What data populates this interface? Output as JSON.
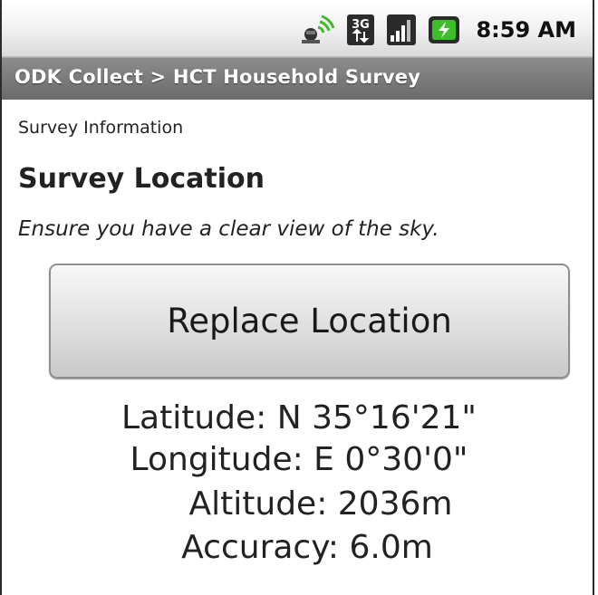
{
  "status_bar": {
    "time": "8:59 AM",
    "icons": [
      "gps-satellite-icon",
      "3g-data-icon",
      "signal-strength-icon",
      "battery-charging-icon"
    ],
    "network_label": "3G"
  },
  "title_bar": {
    "title": "ODK Collect > HCT Household Survey"
  },
  "form": {
    "group_label": "Survey Information",
    "question_title": "Survey Location",
    "question_hint": "Ensure you have a clear view of the sky.",
    "replace_button_label": "Replace Location",
    "location": {
      "latitude": "Latitude: N 35°16'21\"",
      "longitude": "Longitude: E 0°30'0\"",
      "altitude": "Altitude: 2036m",
      "accuracy": "Accuracy: 6.0m"
    }
  },
  "colors": {
    "title_bar": "#7a7a7a",
    "battery_green": "#3cbf2b",
    "gps_green": "#44b82c"
  }
}
